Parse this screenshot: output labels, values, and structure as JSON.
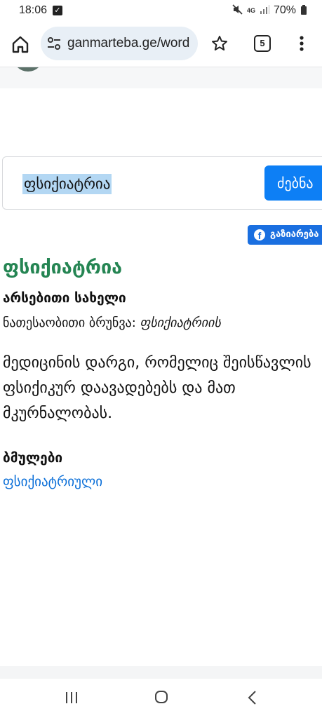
{
  "status_bar": {
    "time": "18:06",
    "network": "4G",
    "battery": "70%"
  },
  "browser": {
    "url": "ganmarteba.ge/word",
    "tab_count": "5"
  },
  "search": {
    "query": "ფსიქიატრია",
    "button_label": "ძებნა"
  },
  "share": {
    "label": "გაზიარება"
  },
  "entry": {
    "headword": "ფსიქიატრია",
    "part_of_speech": "არსებითი სახელი",
    "genitive_label": "ნათესაობითი ბრუნვა:",
    "genitive_value": "ფსიქიატრიის",
    "definition": "მედიცინის დარგი, რომელიც შეისწავლის ფსიქიკურ დაავადებებს და მათ მკურნალობას.",
    "related_heading": "ბმულები",
    "related_link": "ფსიქიატრიული"
  },
  "colors": {
    "headword": "#258553",
    "link": "#0b6fd8",
    "search_button": "#0d7ff5",
    "share_button": "#1a6fe0",
    "url_pill": "#e8eff6"
  },
  "icons": [
    "home-icon",
    "site-settings-icon",
    "star-icon",
    "tabs-icon",
    "more-icon",
    "facebook-icon",
    "recents-icon",
    "nav-home-icon",
    "back-icon",
    "mute-icon",
    "signal-icon",
    "battery-icon"
  ]
}
